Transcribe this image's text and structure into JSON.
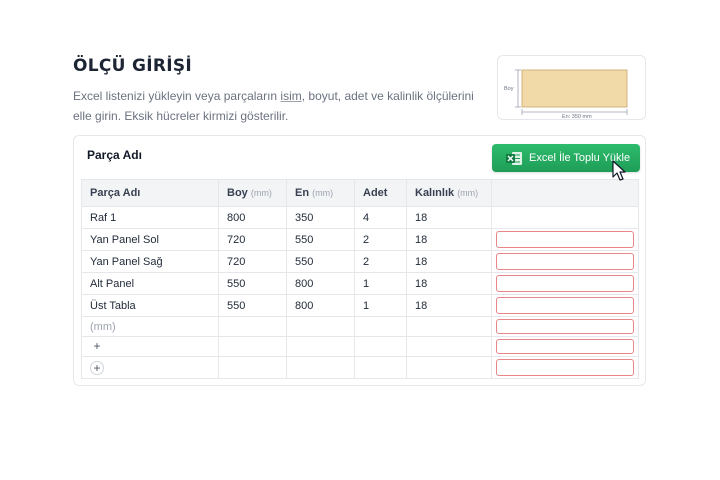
{
  "header": {
    "title": "ÖLÇÜ GİRİŞİ",
    "desc_part1": "Excel listenizi yükleyin veya parçaların ",
    "desc_link": "isim",
    "desc_part2": ", boyut, adet ve kalinlik ölçülerini elle girin. Eksik hücreler kirmizi gösterilir."
  },
  "diagram": {
    "height_label": "Boy",
    "width_label": "En: 350 mm"
  },
  "card": {
    "title": "Parça Adı",
    "upload_button": "Excel İle Toplu Yükle"
  },
  "table": {
    "columns": [
      {
        "label": "Parça Adı",
        "unit": ""
      },
      {
        "label": "Boy",
        "unit": "(mm)"
      },
      {
        "label": "En",
        "unit": "(mm)"
      },
      {
        "label": "Adet",
        "unit": ""
      },
      {
        "label": "Kalınlık",
        "unit": "(mm)"
      }
    ],
    "rows": [
      [
        "Raf 1",
        "800",
        "350",
        "4",
        "18"
      ],
      [
        "Yan Panel Sol",
        "720",
        "550",
        "2",
        "18"
      ],
      [
        "Yan Panel Sağ",
        "720",
        "550",
        "2",
        "18"
      ],
      [
        "Alt Panel",
        "550",
        "800",
        "1",
        "18"
      ],
      [
        "Üst Tabla",
        "550",
        "800",
        "1",
        "18"
      ]
    ],
    "empty_row_hint": "(mm)",
    "add_symbol": "+"
  },
  "colors": {
    "accent_green": "#1f9d57",
    "missing_cell_border": "#e8868a"
  }
}
